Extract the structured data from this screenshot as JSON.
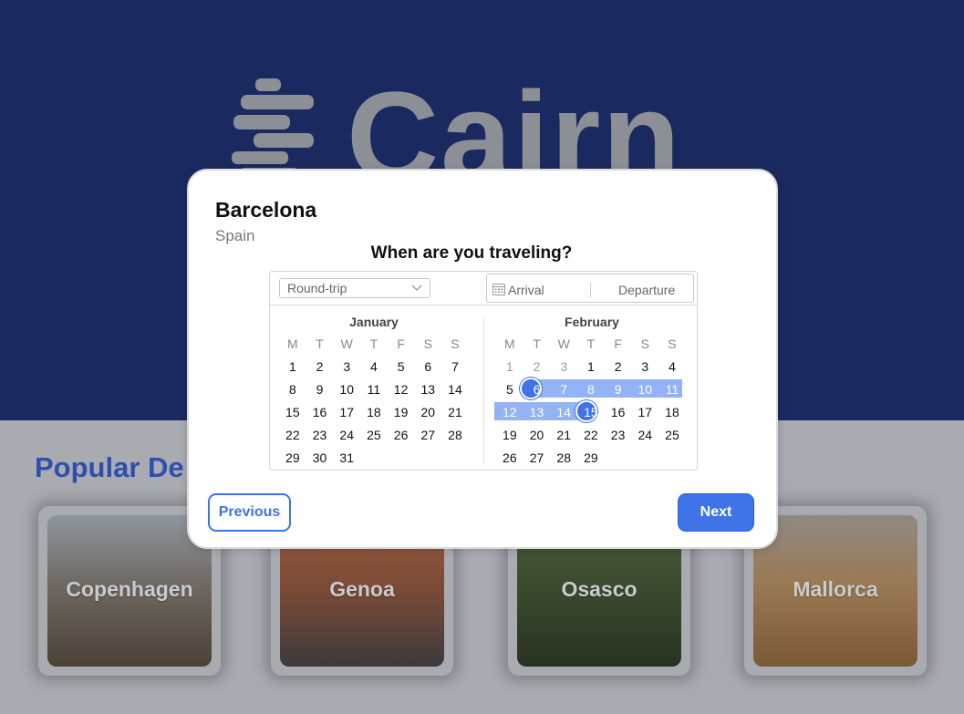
{
  "brand": {
    "name": "Cairn"
  },
  "section": {
    "title": "Popular De"
  },
  "destinations": [
    {
      "name": "Copenhagen"
    },
    {
      "name": "Genoa"
    },
    {
      "name": "Osasco"
    },
    {
      "name": "Mallorca"
    }
  ],
  "modal": {
    "city": "Barcelona",
    "country": "Spain",
    "question": "When are you traveling?",
    "trip_type": "Round-trip",
    "arrival_placeholder": "Arrival",
    "departure_placeholder": "Departure",
    "previous_label": "Previous",
    "next_label": "Next"
  },
  "calendar": {
    "weekdays": [
      "M",
      "T",
      "W",
      "T",
      "F",
      "S",
      "S"
    ],
    "january": {
      "name": "January",
      "weeks": [
        [
          "1",
          "2",
          "3",
          "4",
          "5",
          "6",
          "7"
        ],
        [
          "8",
          "9",
          "10",
          "11",
          "12",
          "13",
          "14"
        ],
        [
          "15",
          "16",
          "17",
          "18",
          "19",
          "20",
          "21"
        ],
        [
          "22",
          "23",
          "24",
          "25",
          "26",
          "27",
          "28"
        ],
        [
          "29",
          "30",
          "31",
          "",
          "",
          "",
          ""
        ]
      ]
    },
    "february": {
      "name": "February",
      "weeks": [
        [
          "1",
          "2",
          "3",
          "1",
          "2",
          "3",
          "4"
        ],
        [
          "5",
          "6",
          "7",
          "8",
          "9",
          "10",
          "11"
        ],
        [
          "12",
          "13",
          "14",
          "15",
          "16",
          "17",
          "18"
        ],
        [
          "19",
          "20",
          "21",
          "22",
          "23",
          "24",
          "25"
        ],
        [
          "26",
          "27",
          "28",
          "29",
          "",
          "",
          ""
        ]
      ]
    },
    "selected_start": "6",
    "selected_end": "15",
    "accent_color": "#3f73e8",
    "range_color": "#93b3f6"
  }
}
